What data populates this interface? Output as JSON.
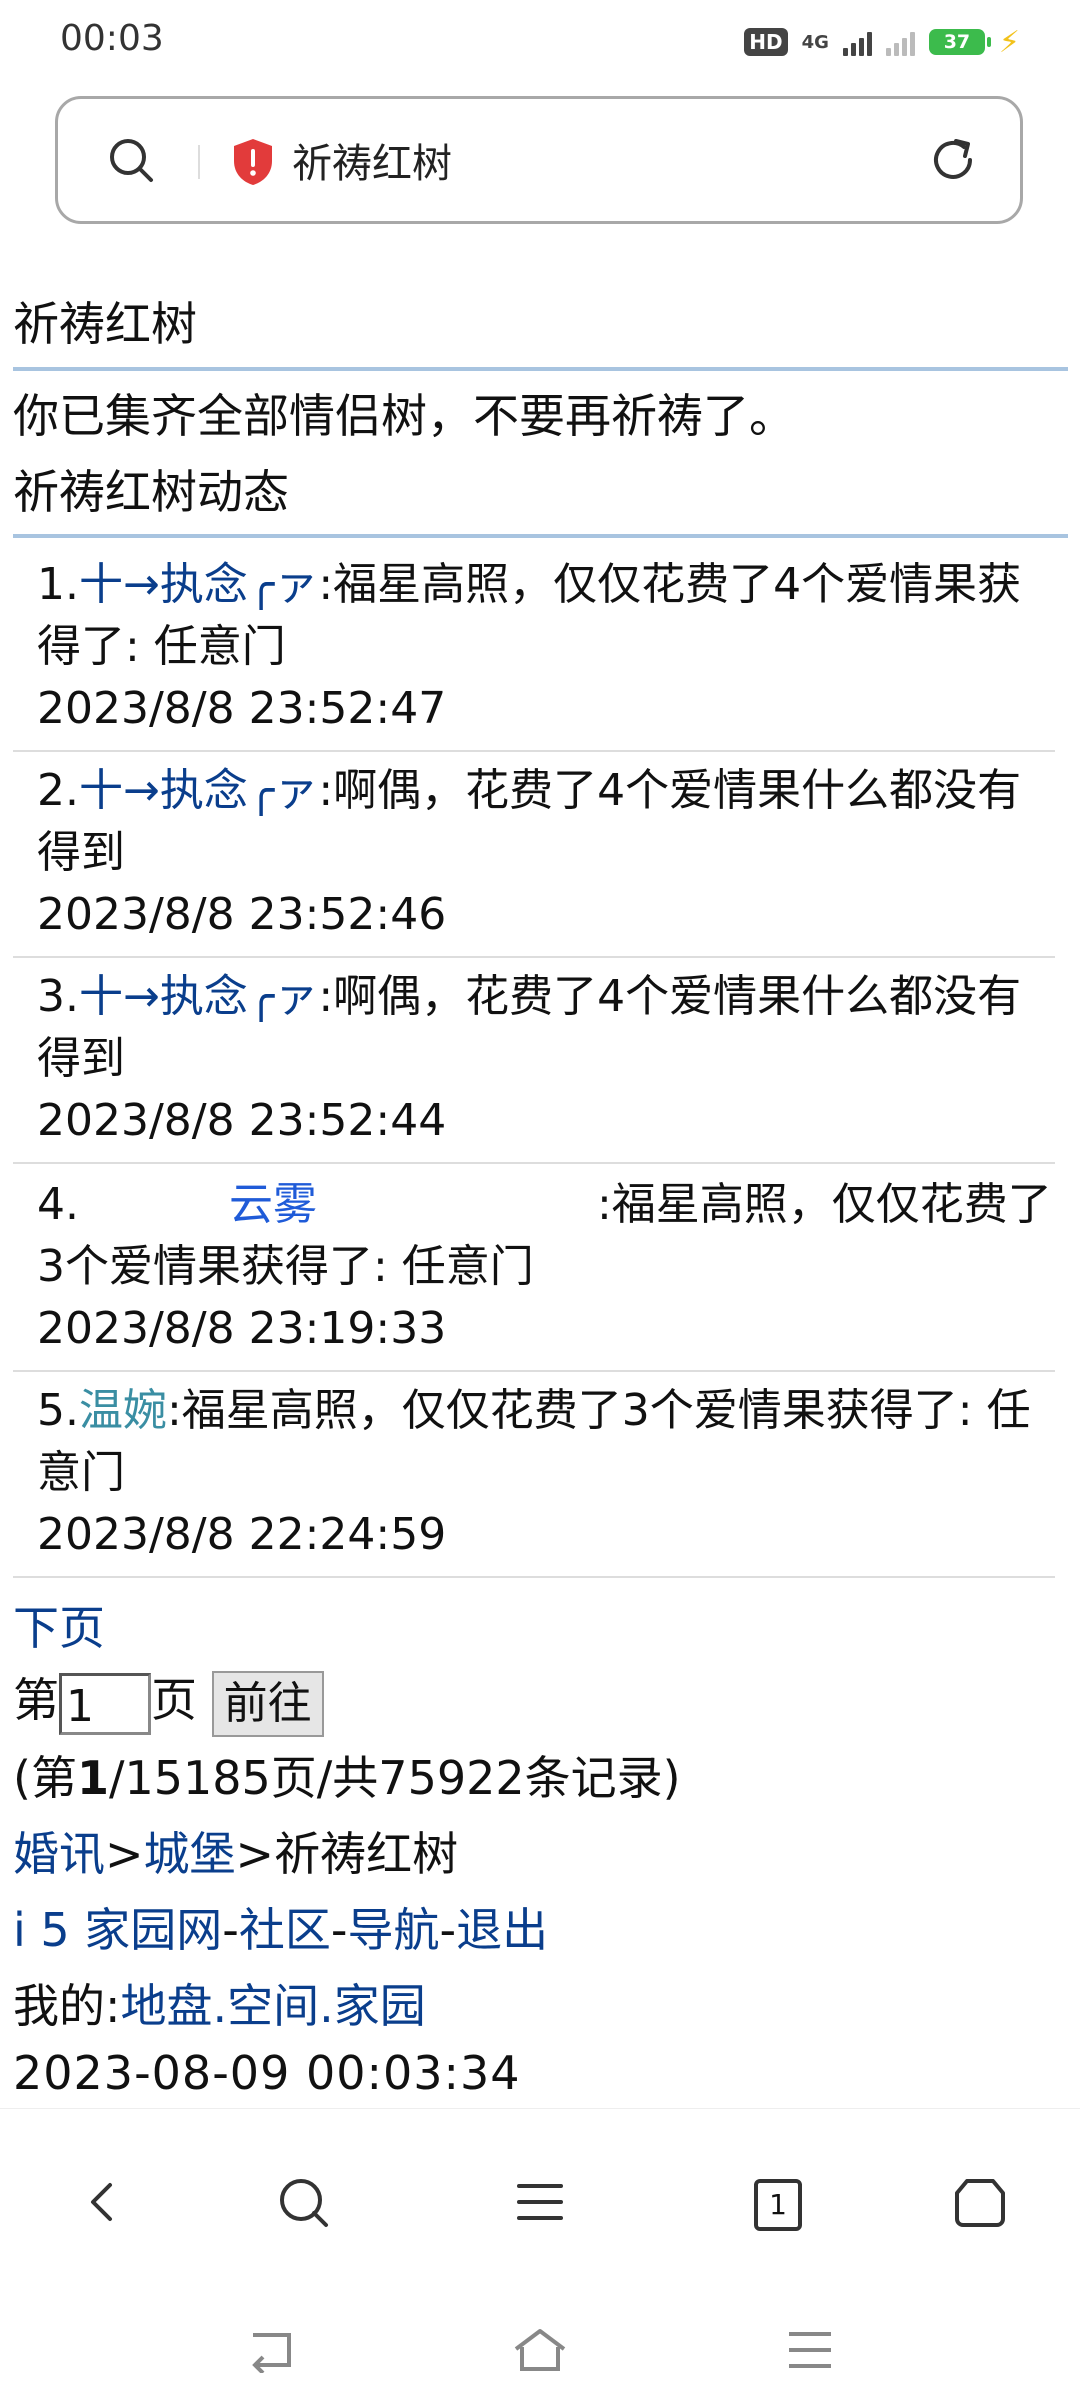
{
  "status_bar": {
    "time": "00:03",
    "hd_label": "HD",
    "network_label": "4G",
    "battery_level": "37",
    "accent_battery": "#3cbb4c"
  },
  "address_bar": {
    "title": "祈祷红树",
    "search_icon": "search-icon",
    "security_icon": "shield-alert-icon",
    "reload_icon": "reload-icon"
  },
  "page": {
    "title": "祈祷红树",
    "message": "你已集齐全部情侣树，不要再祈祷了。",
    "section_title": "祈祷红树动态",
    "entries": [
      {
        "index": "1.",
        "user": "十→执念╭ァ",
        "text": ":福星高照，仅仅花费了4个爱情果获得了: 任意门",
        "time": "2023/8/8 23:52:47"
      },
      {
        "index": "2.",
        "user": "十→执念╭ァ",
        "text": ":啊偶，花费了4个爱情果什么都没有得到",
        "time": "2023/8/8 23:52:46"
      },
      {
        "index": "3.",
        "user": "十→执念╭ァ",
        "text": ":啊偶，花费了4个爱情果什么都没有得到",
        "time": "2023/8/8 23:52:44"
      },
      {
        "index": "4.",
        "user": "云雾",
        "text": ":福星高照，仅仅花费了3个爱情果获得了: 任意门",
        "time": "2023/8/8 23:19:33"
      },
      {
        "index": "5.",
        "user": "温婉",
        "text": ":福星高照，仅仅花费了3个爱情果获得了: 任意门",
        "time": "2023/8/8 22:24:59"
      }
    ],
    "next_page_label": "下页",
    "page_prefix": "第",
    "page_input_value": "1",
    "page_suffix": "页",
    "goto_label": "前往",
    "record_summary_open": "(第",
    "record_current_page": "1",
    "record_summary_rest": "/15185页/共75922条记录)",
    "breadcrumb": {
      "item1": "婚讯",
      "sep": ">",
      "item2": "城堡",
      "current": "祈祷红树"
    },
    "nav_links": {
      "home": "i 5 家园网",
      "dash": "-",
      "community": "社区",
      "navigation": "导航",
      "logout": "退出"
    },
    "mine": {
      "label": "我的:",
      "land": "地盘",
      "dot": ".",
      "space": "空间",
      "home": "家园"
    },
    "timestamp": "2023-08-09 00:03:34"
  },
  "toolbar": {
    "back_icon": "back-icon",
    "search_icon": "search-icon",
    "menu_icon": "menu-icon",
    "tab_count": "1",
    "home_icon": "home-icon"
  },
  "colors": {
    "link": "#0a3e8c",
    "user_blue": "#1f5bd8",
    "user_teal": "#3a8ea3",
    "rule": "#a8c4e0"
  }
}
